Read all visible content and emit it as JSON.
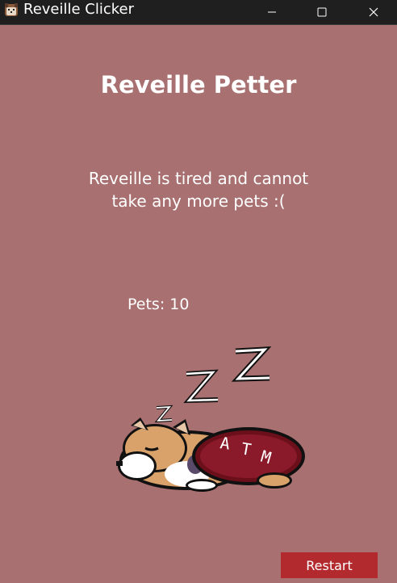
{
  "window": {
    "title": "Reveille Clicker",
    "app_icon": "dog-face-icon",
    "controls": [
      "minimize-icon",
      "maximize-icon",
      "close-icon"
    ]
  },
  "main": {
    "heading": "Reveille Petter",
    "status_message": "Reveille is tired and cannot take any more pets :(",
    "pets_label": "Pets: 10",
    "image": "sleeping-reveille-dog",
    "restart_label": "Restart"
  },
  "colors": {
    "background": "#a87070",
    "titlebar": "#1f1f1f",
    "restart_button": "#b22a2e",
    "text": "#ffffff"
  }
}
